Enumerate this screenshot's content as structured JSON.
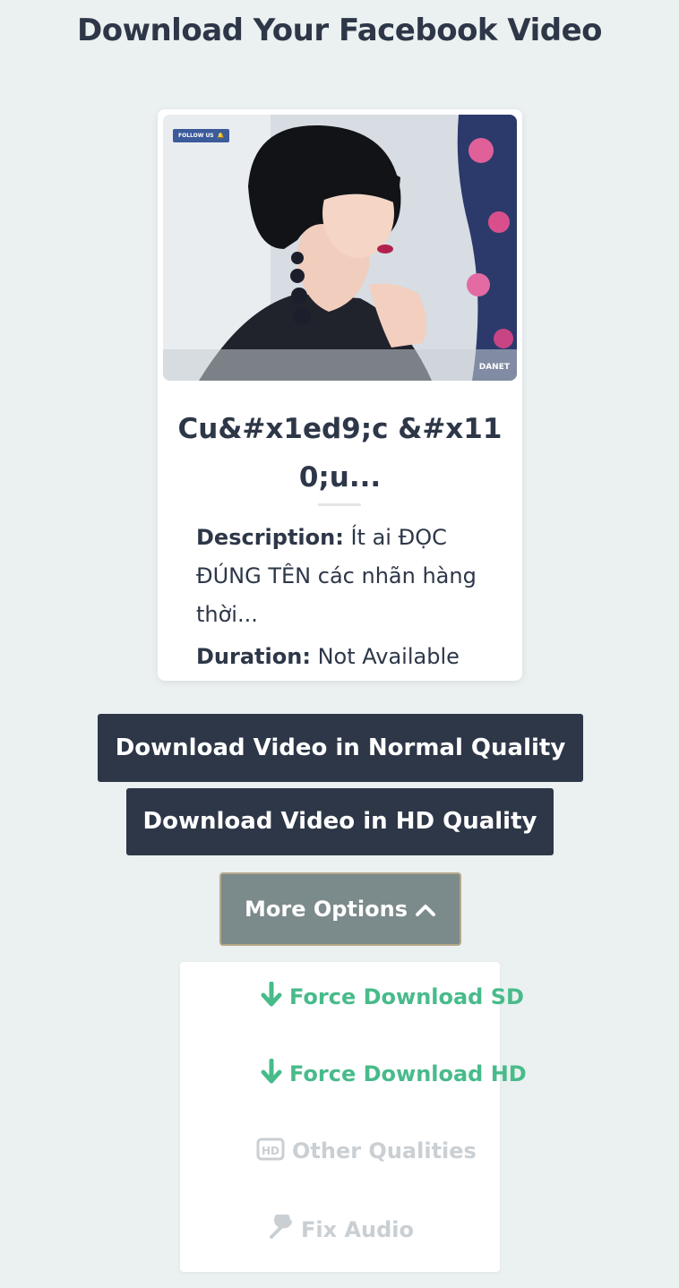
{
  "page": {
    "title": "Download Your Facebook Video"
  },
  "card": {
    "follow_badge": "FOLLOW US",
    "brand_mark": "DANET",
    "video_title": "Cu&#x1ed9;c &#x110;u...",
    "description_label": "Description:",
    "description_value": "Ít ai ĐỌC ĐÚNG TÊN các nhãn hàng thời...",
    "duration_label": "Duration:",
    "duration_value": "Not Available"
  },
  "buttons": {
    "normal_quality": "Download Video in Normal Quality",
    "hd_quality": "Download Video in HD Quality",
    "more_options": "More Options"
  },
  "menu": {
    "items": [
      {
        "label": "Force Download SD",
        "icon": "arrow-down-icon",
        "enabled": true
      },
      {
        "label": "Force Download HD",
        "icon": "arrow-down-icon",
        "enabled": true
      },
      {
        "label": "Other Qualities",
        "icon": "hd-icon",
        "enabled": false
      },
      {
        "label": "Fix Audio",
        "icon": "wrench-icon",
        "enabled": false
      }
    ]
  },
  "colors": {
    "background": "#ebf0f0",
    "dark_button": "#2d3748",
    "more_button": "#7b8a8b",
    "accent_green": "#48bb8a",
    "disabled": "#c9cfd3"
  }
}
